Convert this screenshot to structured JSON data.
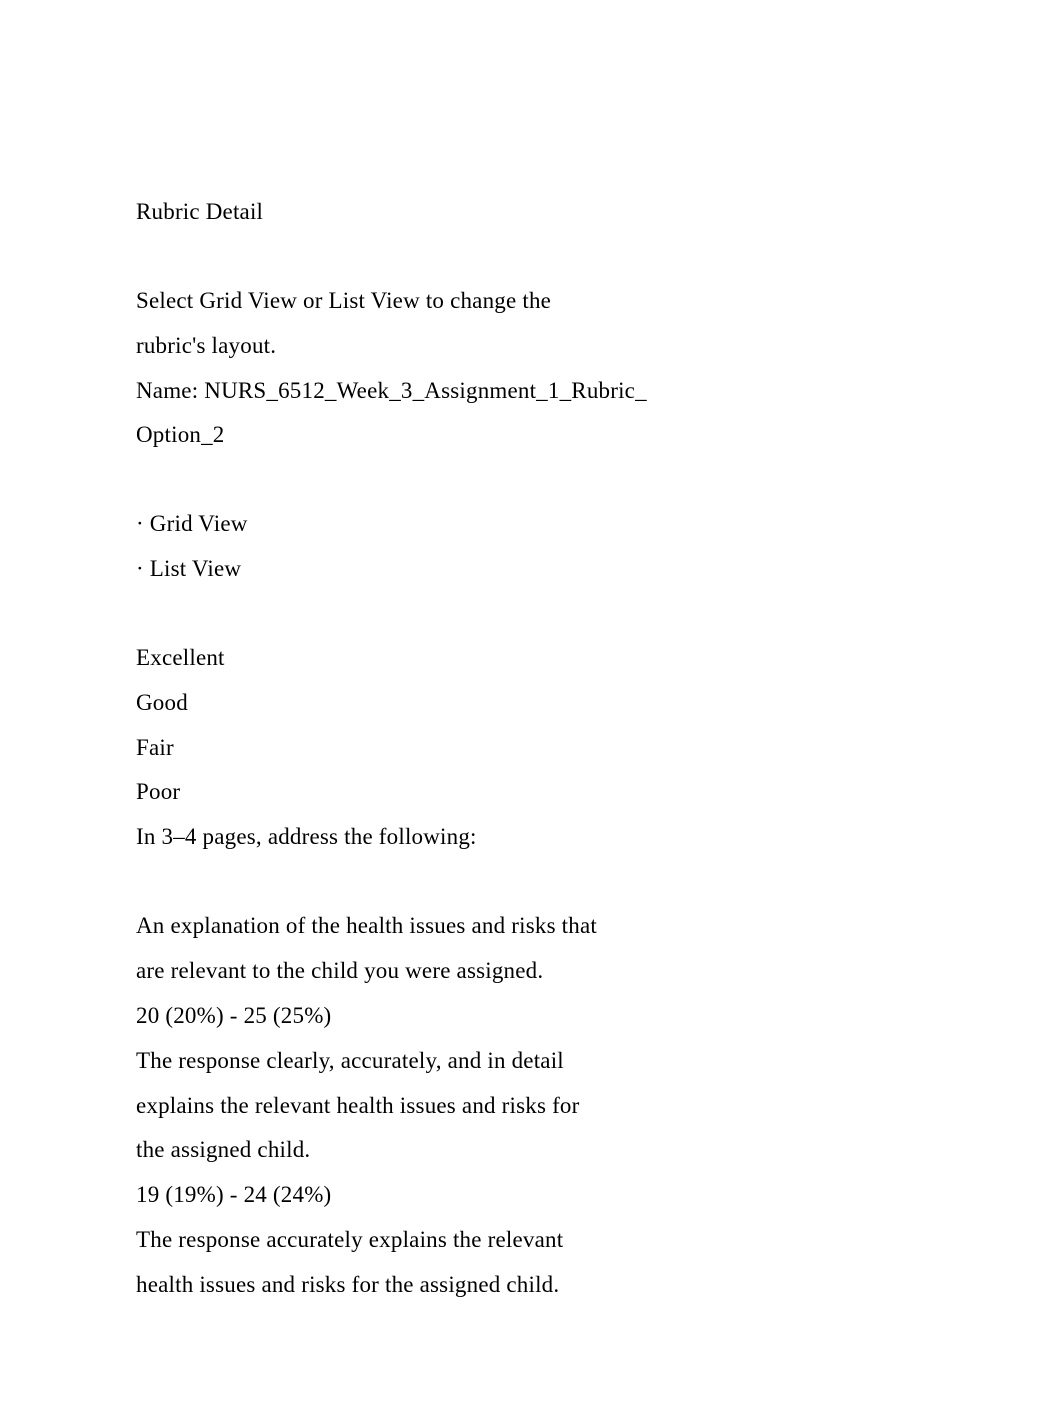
{
  "heading": "Rubric Detail",
  "intro": {
    "line1": "Select Grid View or List View to change the",
    "line2": "rubric's layout.",
    "line3": "Name: NURS_6512_Week_3_Assignment_1_Rubric_",
    "line4": "Option_2"
  },
  "views": {
    "item1": "· Grid View",
    "item2": "· List View"
  },
  "levels": {
    "l1": "Excellent",
    "l2": "Good",
    "l3": "Fair",
    "l4": "Poor",
    "instructions": "In 3–4 pages, address the following:"
  },
  "criterion": {
    "line1": "An explanation of the health issues and risks that",
    "line2": "are relevant to the child you were assigned.",
    "excellent_points": "20 (20%) - 25 (25%)",
    "excellent_desc_l1": "The response clearly, accurately, and in detail",
    "excellent_desc_l2": "explains the relevant health issues and risks for",
    "excellent_desc_l3": "the assigned child.",
    "good_points": "19 (19%) - 24 (24%)",
    "good_desc_l1": "The response accurately explains the relevant",
    "good_desc_l2": "health issues and risks for the assigned child."
  }
}
